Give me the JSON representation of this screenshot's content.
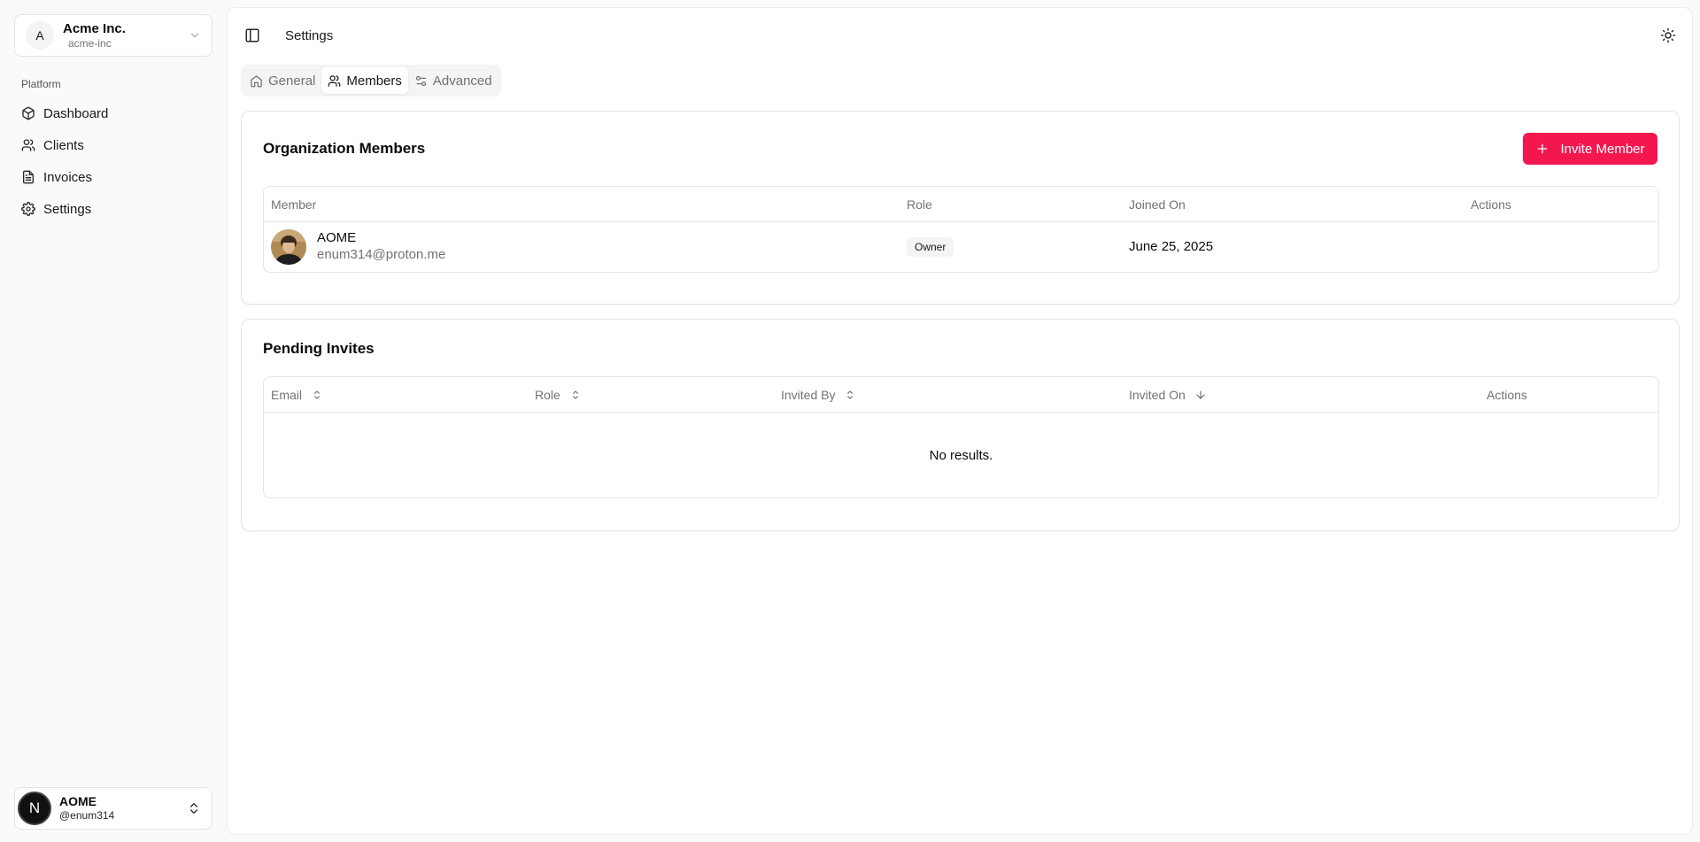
{
  "org": {
    "initial": "A",
    "name": "Acme Inc.",
    "slug": "acme-inc"
  },
  "sidebar": {
    "group_label": "Platform",
    "items": [
      {
        "label": "Dashboard",
        "icon": "box-icon"
      },
      {
        "label": "Clients",
        "icon": "users-icon"
      },
      {
        "label": "Invoices",
        "icon": "file-text-icon"
      },
      {
        "label": "Settings",
        "icon": "gear-icon"
      }
    ]
  },
  "user": {
    "initial": "N",
    "name": "AOME",
    "handle": "@enum314"
  },
  "header": {
    "title": "Settings"
  },
  "tabs": [
    {
      "label": "General",
      "icon": "home-icon",
      "active": false
    },
    {
      "label": "Members",
      "icon": "users-icon",
      "active": true
    },
    {
      "label": "Advanced",
      "icon": "sliders-icon",
      "active": false
    }
  ],
  "members": {
    "title": "Organization Members",
    "invite_label": "Invite Member",
    "columns": [
      "Member",
      "Role",
      "Joined On",
      "Actions"
    ],
    "rows": [
      {
        "name": "AOME",
        "email": "enum314@proton.me",
        "role": "Owner",
        "joined": "June 25, 2025"
      }
    ]
  },
  "invites": {
    "title": "Pending Invites",
    "columns": [
      "Email",
      "Role",
      "Invited By",
      "Invited On",
      "Actions"
    ],
    "empty_text": "No results."
  },
  "colors": {
    "accent": "#f4174f",
    "border": "#e4e4e7",
    "muted": "#71717a"
  }
}
